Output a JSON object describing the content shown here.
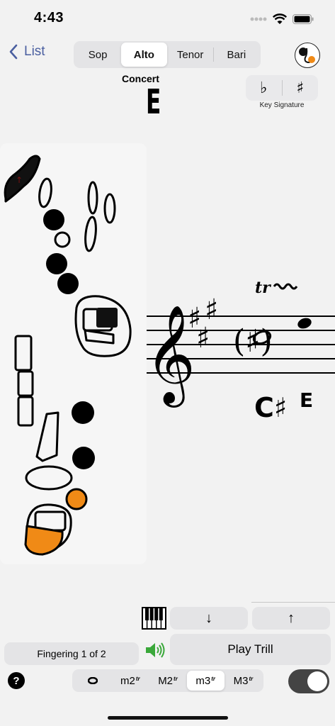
{
  "status": {
    "time": "4:43"
  },
  "nav": {
    "back_label": "List",
    "voices": [
      "Sop",
      "Alto",
      "Tenor",
      "Bari"
    ],
    "active_voice": "Alto"
  },
  "concert": {
    "label": "Concert",
    "note": "E"
  },
  "key_signature": {
    "flat": "♭",
    "sharp": "♯",
    "label": "Key Signature"
  },
  "staff": {
    "trill_mark": "tr",
    "note_labels": [
      "C♯",
      "E"
    ]
  },
  "controls": {
    "down_symbol": "↓",
    "up_symbol": "↑",
    "fingering_label": "Fingering 1 of 2",
    "play_trill_label": "Play Trill",
    "help_symbol": "?",
    "intervals": [
      "o",
      "m2",
      "M2",
      "m3",
      "M3"
    ],
    "interval_suffix": "tr",
    "active_interval": "m3",
    "toggle_on": true
  },
  "colors": {
    "accent_orange": "#f08a16",
    "link_blue": "#4a5fa0",
    "speaker_green": "#3aa83a"
  }
}
